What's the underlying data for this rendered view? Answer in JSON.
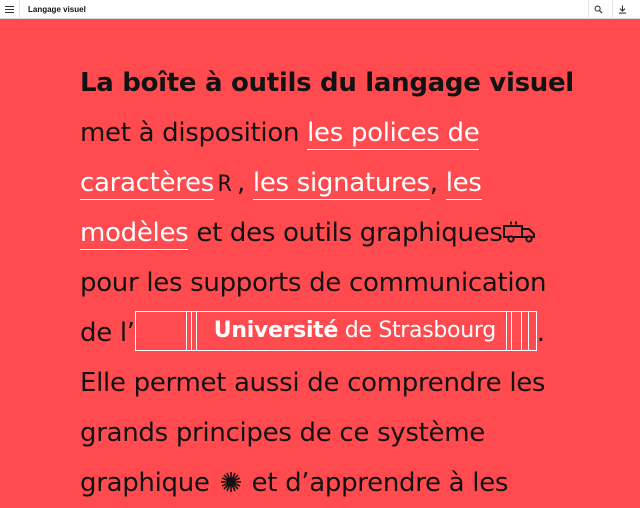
{
  "header": {
    "title": "Langage visuel",
    "menu_icon": "hamburger-menu-icon",
    "search_icon": "search-icon",
    "download_icon": "download-icon"
  },
  "colors": {
    "background": "#ff4b4f",
    "text": "#121212",
    "link": "#ffffff"
  },
  "content": {
    "heading": "La boîte à outils du langage visuel",
    "l2_text": "met à disposition ",
    "link_polices_1": "les polices de",
    "link_polices_2": "caractères",
    "glyph_r": "R",
    "comma_1": ", ",
    "link_signatures": "les signatures",
    "comma_2": ", ",
    "link_modeles_1": "les",
    "link_modeles_2": "modèles",
    "l4_text": " et des outils graphiques",
    "l5_text": "pour les supports de communication",
    "l6_text": "de l’",
    "logo_bold": "Université",
    "logo_regular": " de Strasbourg",
    "l6_end": ".",
    "l7_text": "Elle permet aussi de comprendre les",
    "l8_text": "grands principes de ce système",
    "l9_text_a": "graphique ",
    "l9_text_b": " et d’apprendre à les"
  },
  "icons": {
    "truck": "truck-icon",
    "burst": "burst-icon"
  }
}
